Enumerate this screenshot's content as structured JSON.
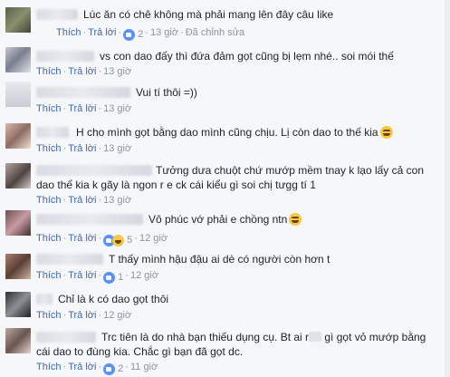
{
  "colors": {
    "link": "#4267b2",
    "meta": "#90949c",
    "like": "#5890ff",
    "haha": "#f7c841"
  },
  "comments": [
    {
      "text_lines": [
        "Lúc ăn có chê không mà phải mang lên đây câu like"
      ],
      "reply": "Thích",
      "respond": "Trả lời",
      "react_icons": [
        "like-icon"
      ],
      "react_count": "2",
      "time": "13 giờ",
      "extra": "Đã chỉnh sửa"
    },
    {
      "text_lines": [
        "vs con dao đấy thì đứa đảm gọt cũng bị lẹm nhé.. soi mói thế"
      ],
      "reply": "Thích",
      "respond": "Trả lời",
      "react_icons": [],
      "react_count": "",
      "time": "13 giờ",
      "extra": ""
    },
    {
      "text_lines": [
        "Vui tí thôi =))"
      ],
      "reply": "Thích",
      "respond": "Trả lời",
      "react_icons": [],
      "react_count": "",
      "time": "13 giờ",
      "extra": ""
    },
    {
      "text_lines": [
        "H cho mình gọt bằng dao mình cũng chịu. Lị còn dao to thế kia"
      ],
      "emoji_after": "crying-emoji",
      "reply": "Thích",
      "respond": "Trả lời",
      "react_icons": [],
      "react_count": "",
      "time": "13 giờ",
      "extra": ""
    },
    {
      "text_lines": [
        "Tưởng dưa chuột chứ mướp mềm tnay k lạo lấy cả con",
        "dao thế kia k gãy là ngon r e ck cái kiểu gì soi chị tưgg tí 1"
      ],
      "reply": "Thích",
      "respond": "Trả lời",
      "react_icons": [],
      "react_count": "",
      "time": "13 giờ",
      "extra": ""
    },
    {
      "text_lines": [
        "Vô phúc vớ phải e chồng ntn"
      ],
      "emoji_after": "laughing-emoji",
      "reply": "Thích",
      "respond": "Trả lời",
      "react_icons": [
        "like-icon",
        "haha-icon"
      ],
      "react_count": "5",
      "time": "12 giờ",
      "extra": ""
    },
    {
      "text_lines": [
        "T thấy mình hậu đậu ai dè có người còn hơn t"
      ],
      "reply": "Thích",
      "respond": "Trả lời",
      "react_icons": [
        "like-icon"
      ],
      "react_count": "1",
      "time": "12 giờ",
      "extra": ""
    },
    {
      "text_lines": [
        "Chỉ là k có dao gọt thôi"
      ],
      "reply": "Thích",
      "respond": "Trả lời",
      "react_icons": [],
      "react_count": "",
      "time": "12 giờ",
      "extra": ""
    },
    {
      "text_lines": [
        "Trc tiên là do nhà bạn thiếu dụng cụ. Bt ai r",
        "gì gọt vỏ mướp bằng",
        "cái dao to đùng kia. Chắc gì bạn đã gọt dc."
      ],
      "reply": "Thích",
      "respond": "Trả lời",
      "react_icons": [
        "like-icon"
      ],
      "react_count": "2",
      "time": "11 giờ",
      "extra": ""
    }
  ]
}
